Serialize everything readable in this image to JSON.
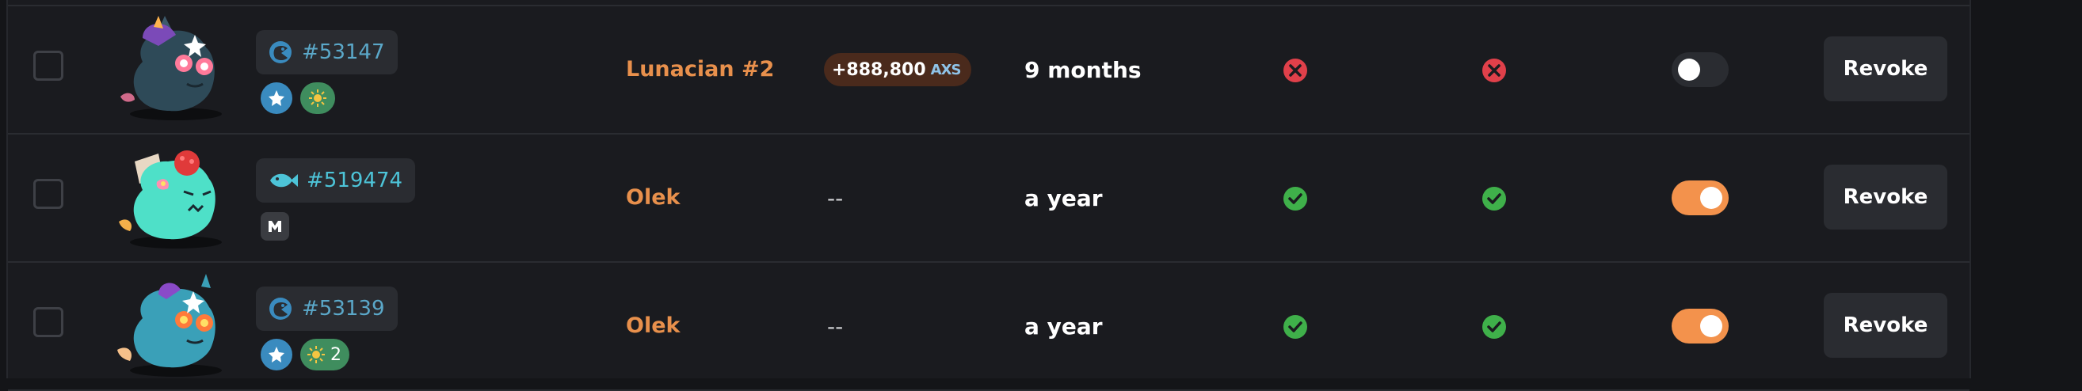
{
  "colors": {
    "owner": "#e8904c",
    "id_text": "#5ba8c9",
    "toggle_on": "#f3924c",
    "check_green": "#3fb04a",
    "cross_red": "#e0404a"
  },
  "rows": [
    {
      "id": "#53147",
      "class_icon": "reptile-icon",
      "badges": [
        {
          "type": "blue",
          "icon": "star-icon"
        },
        {
          "type": "green",
          "icon": "sun-icon",
          "count": ""
        }
      ],
      "owner": "Lunacian #2",
      "price": "+888,800",
      "price_unit": "AXS",
      "duration": "9 months",
      "status_1": "cross",
      "status_2": "cross",
      "toggle_on": false,
      "revoke_label": "Revoke"
    },
    {
      "id": "#519474",
      "class_icon": "aquatic-fish-icon",
      "badges": [
        {
          "type": "mystic",
          "icon": "mystic-m-icon"
        }
      ],
      "owner": "Olek",
      "price": "--",
      "duration": "a year",
      "status_1": "check",
      "status_2": "check",
      "toggle_on": true,
      "revoke_label": "Revoke"
    },
    {
      "id": "#53139",
      "class_icon": "reptile-icon",
      "badges": [
        {
          "type": "blue",
          "icon": "star-icon"
        },
        {
          "type": "green",
          "icon": "sun-icon",
          "count": "2"
        }
      ],
      "owner": "Olek",
      "price": "--",
      "duration": "a year",
      "status_1": "check",
      "status_2": "check",
      "toggle_on": true,
      "revoke_label": "Revoke"
    }
  ]
}
